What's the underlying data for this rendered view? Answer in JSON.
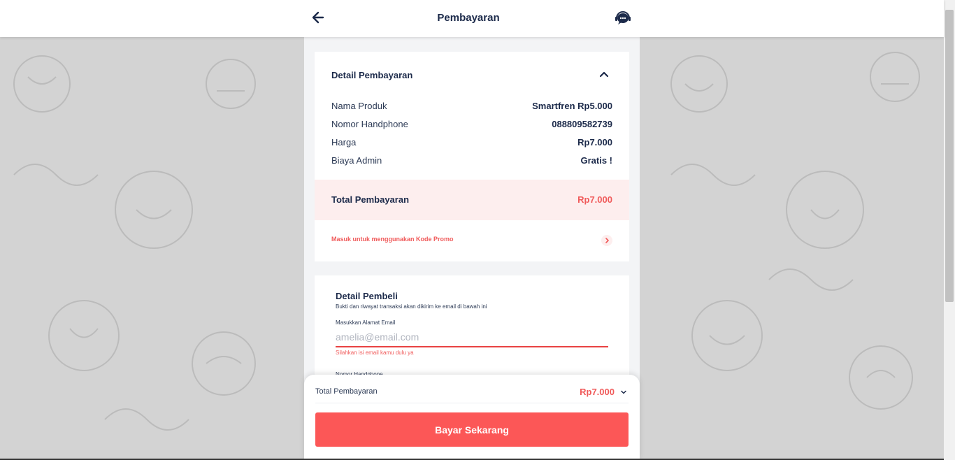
{
  "header": {
    "title": "Pembayaran",
    "back_icon": "arrow-left-icon",
    "support_icon": "customer-service-chat-icon"
  },
  "payment_details": {
    "title": "Detail Pembayaran",
    "collapse_icon": "chevron-up-icon",
    "rows": [
      {
        "label": "Nama Produk",
        "value": "Smartfren Rp5.000"
      },
      {
        "label": "Nomor Handphone",
        "value": "088809582739"
      },
      {
        "label": "Harga",
        "value": "Rp7.000"
      },
      {
        "label": "Biaya Admin",
        "value": "Gratis !"
      }
    ],
    "total_label": "Total Pembayaran",
    "total_value": "Rp7.000",
    "promo_text": "Masuk untuk menggunakan Kode Promo",
    "promo_icon": "chevron-right-icon"
  },
  "buyer": {
    "title": "Detail Pembeli",
    "subtitle": "Bukti dan riwayat transaksi akan dikirim ke email di bawah ini",
    "email_label": "Masukkan Alamat Email",
    "email_placeholder": "amelia@email.com",
    "email_value": "",
    "email_error": "Silahkan isi email kamu dulu ya",
    "next_field_label": "Nomor Handphone"
  },
  "bottom_bar": {
    "total_label": "Total Pembayaran",
    "total_value": "Rp7.000",
    "expand_icon": "chevron-down-icon",
    "pay_button": "Bayar Sekarang"
  },
  "colors": {
    "accent": "#fc5757",
    "accent_text": "#f05a5a",
    "navy": "#1c2a4a",
    "total_band": "#fdeeee",
    "page_background": "#d3d3d3"
  }
}
